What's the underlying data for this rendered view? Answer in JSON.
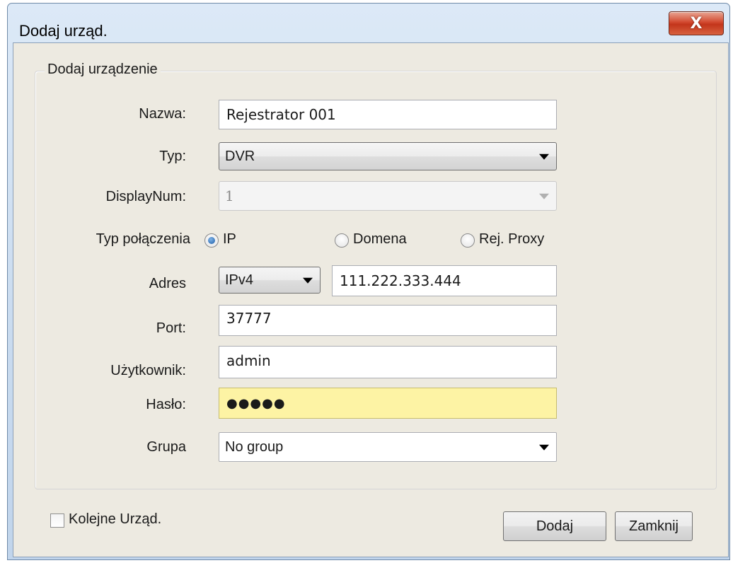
{
  "window": {
    "title": "Dodaj urząd.",
    "close_glyph": "X"
  },
  "group": {
    "title": "Dodaj urządzenie"
  },
  "fields": {
    "name": {
      "label": "Nazwa:",
      "value": "Rejestrator 001"
    },
    "type": {
      "label": "Typ:",
      "selected": "DVR"
    },
    "display_num": {
      "label": "DisplayNum:",
      "selected": "1"
    },
    "connection": {
      "label": "Typ połączenia",
      "options": [
        "IP",
        "Domena",
        "Rej. Proxy"
      ],
      "selected": "IP"
    },
    "address": {
      "label": "Adres",
      "ip_version": "IPv4",
      "value": "111.222.333.444"
    },
    "port": {
      "label": "Port:",
      "value": "37777"
    },
    "user": {
      "label": "Użytkownik:",
      "value": "admin"
    },
    "password": {
      "label": "Hasło:",
      "masked": "●●●●●"
    },
    "group": {
      "label": "Grupa",
      "selected": "No group"
    }
  },
  "footer": {
    "next_checkbox_label": "Kolejne Urząd.",
    "next_checked": false,
    "add_button": "Dodaj",
    "close_button": "Zamknij"
  },
  "colors": {
    "password_highlight": "#fdf3a4",
    "close_button": "#c3351b"
  }
}
